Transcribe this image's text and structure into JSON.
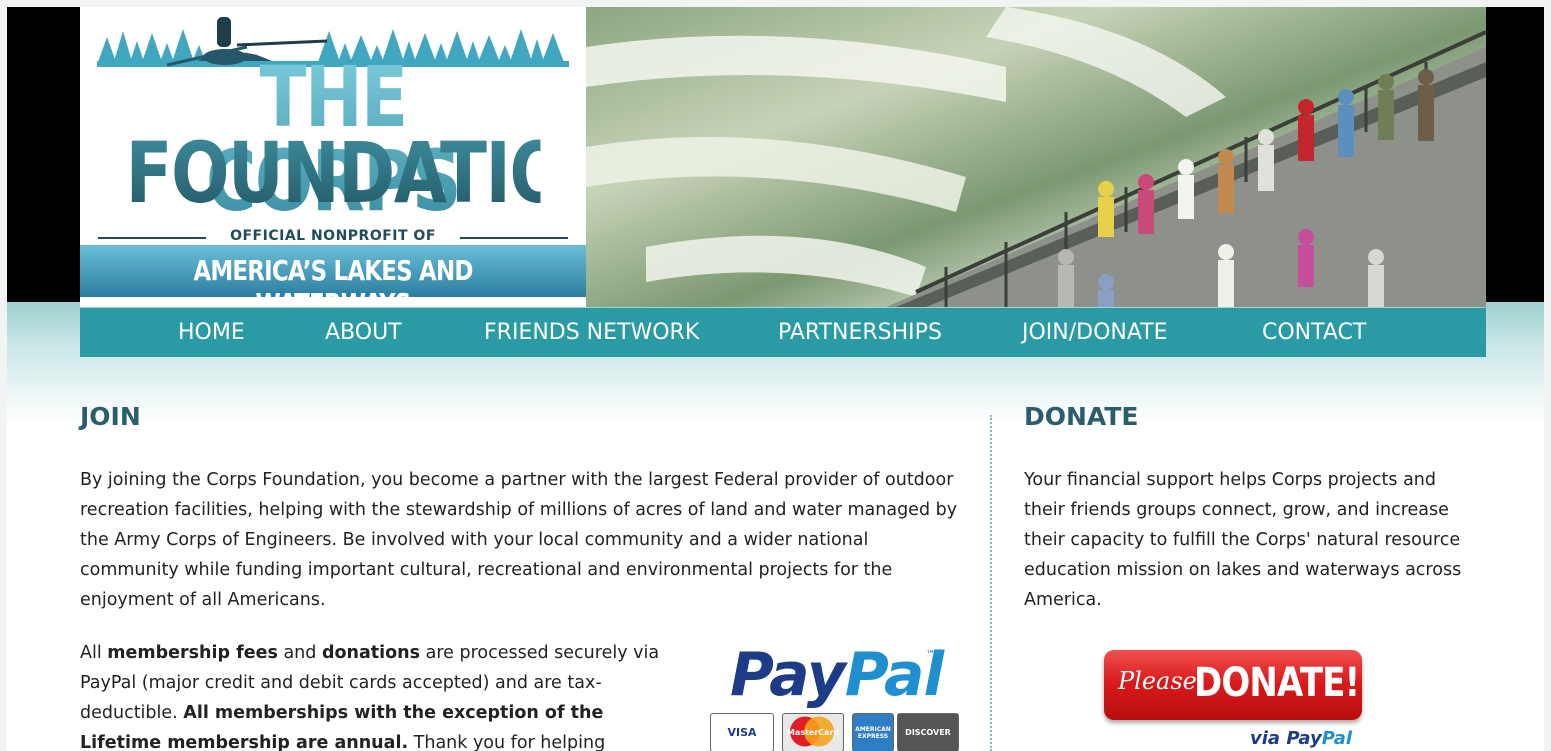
{
  "logo": {
    "line1": "THE CORPS",
    "line2": "FOUNDATION",
    "tagline": "OFFICIAL NONPROFIT OF",
    "band": "AMERICA’S LAKES AND WATERWAYS"
  },
  "nav": {
    "items": [
      {
        "label": "HOME"
      },
      {
        "label": "ABOUT"
      },
      {
        "label": "FRIENDS NETWORK"
      },
      {
        "label": "PARTNERSHIPS"
      },
      {
        "label": "JOIN/DONATE"
      },
      {
        "label": "CONTACT"
      }
    ],
    "color": "#2a9aa4"
  },
  "join": {
    "heading": "JOIN",
    "paragraph1": "By joining the Corps Foundation, you become a partner with the largest Federal provider of outdoor recreation facilities, helping with the stewardship of millions of acres of land and water managed by the Army Corps of Engineers. Be involved with your local community and a wider national community while funding important cultural, recreational and environmental projects for the enjoyment of all Americans.",
    "paragraph2": {
      "t1": "All ",
      "b1": "membership fees",
      "t2": " and ",
      "b2": "donations",
      "t3": " are processed securely via PayPal (major credit and debit cards accepted) and are tax-deductible. ",
      "b3": "All memberships with the exception of the Lifetime membership are annual.",
      "t4": " Thank you for helping"
    }
  },
  "paypal": {
    "pay": "Pay",
    "pal": "Pal",
    "tm": "™",
    "cards": [
      "VISA",
      "MasterCard",
      "AMERICAN EXPRESS",
      "DISCOVER"
    ]
  },
  "donate": {
    "heading": "DONATE",
    "paragraph": "Your financial support helps Corps projects and their friends groups connect, grow, and increase their capacity to fulfill the Corps' natural resource education mission on lakes and waterways across America.",
    "button_please": "Please",
    "button_main": "DONATE!",
    "via": "via",
    "via_pay": "Pay",
    "via_pal": "Pal"
  },
  "colors": {
    "heading": "#2b5d6a",
    "donate_button": "#d9191a",
    "paypal_dark": "#1d3b86",
    "paypal_light": "#1f8fd0"
  }
}
